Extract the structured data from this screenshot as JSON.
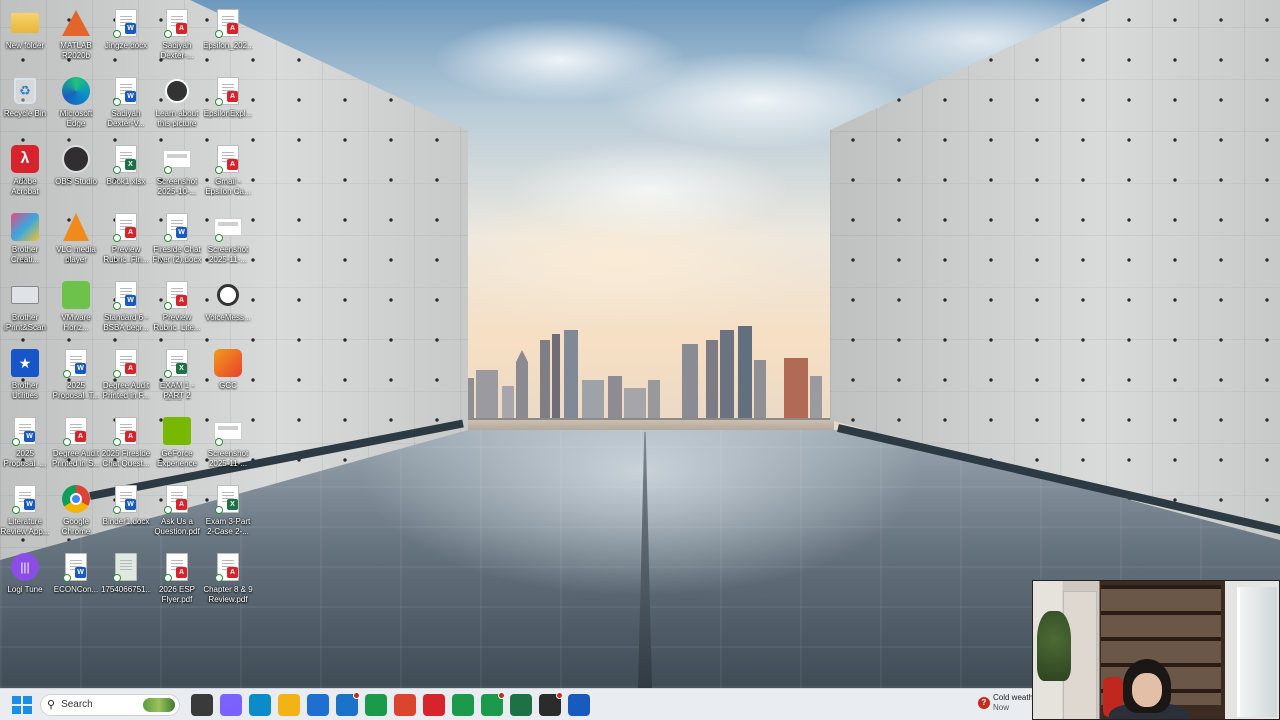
{
  "desktop": {
    "icons": [
      {
        "label": "New folder",
        "icon": "folder-icon"
      },
      {
        "label": "MATLAB R2020b",
        "icon": "matlab-icon"
      },
      {
        "label": "Jingze.docx",
        "icon": "word-doc-icon"
      },
      {
        "label": "Sadiyah Dexter-...",
        "icon": "pdf-doc-icon"
      },
      {
        "label": "Epsilon_202...",
        "icon": "pdf-doc-icon"
      },
      {
        "label": "Recycle Bin",
        "icon": "recycle-bin-icon"
      },
      {
        "label": "Microsoft Edge",
        "icon": "edge-icon"
      },
      {
        "label": "Sadiyah Dexter-V...",
        "icon": "word-doc-icon"
      },
      {
        "label": "Learn about this picture",
        "icon": "learn-picture-icon"
      },
      {
        "label": "EpsilonExpl...",
        "icon": "pdf-doc-icon"
      },
      {
        "label": "Adobe Acrobat",
        "icon": "acrobat-icon"
      },
      {
        "label": "OBS Studio",
        "icon": "obs-icon"
      },
      {
        "label": "Book1.xlsx",
        "icon": "excel-doc-icon"
      },
      {
        "label": "Screenshot 2025-10-...",
        "icon": "screenshot-icon"
      },
      {
        "label": "Gmail - Epsilon Ca...",
        "icon": "pdf-doc-icon"
      },
      {
        "label": "Brother Creati...",
        "icon": "brother-creative-icon"
      },
      {
        "label": "VLC media player",
        "icon": "vlc-icon"
      },
      {
        "label": "Preview Rubric_Fin...",
        "icon": "pdf-doc-icon"
      },
      {
        "label": "Fireside Chat Flyer (2).docx",
        "icon": "word-doc-icon"
      },
      {
        "label": "Screenshot 2025-11-...",
        "icon": "screenshot-icon"
      },
      {
        "label": "Brother iPrint&Scan",
        "icon": "brother-scan-icon"
      },
      {
        "label": "VMware Horiz...",
        "icon": "vmware-icon"
      },
      {
        "label": "Standard 6 -BSBA degr...",
        "icon": "word-doc-icon"
      },
      {
        "label": "Preview Rubric_Lite...",
        "icon": "pdf-doc-icon"
      },
      {
        "label": "VoiceMess...",
        "icon": "voice-message-icon"
      },
      {
        "label": "Brother Utilities",
        "icon": "brother-utilities-icon"
      },
      {
        "label": "2025 Proposal_T...",
        "icon": "word-doc-icon"
      },
      {
        "label": "Degree Audit Printed in F...",
        "icon": "pdf-doc-icon"
      },
      {
        "label": "EXAM 1 - PART 2 EXC...",
        "icon": "excel-doc-icon"
      },
      {
        "label": "GCC",
        "icon": "gcc-icon"
      },
      {
        "label": "2025 Proposal_...",
        "icon": "word-doc-icon"
      },
      {
        "label": "Degree Audit Printed in S...",
        "icon": "pdf-doc-icon"
      },
      {
        "label": "2025 Fireside Chat Quest...",
        "icon": "pdf-doc-icon"
      },
      {
        "label": "GeForce Experience",
        "icon": "geforce-icon"
      },
      {
        "label": "Screenshot 2025-11-...",
        "icon": "screenshot-icon"
      },
      {
        "label": "Literature Review App...",
        "icon": "word-doc-icon"
      },
      {
        "label": "Google Chrome",
        "icon": "chrome-icon"
      },
      {
        "label": "Binder1.docx",
        "icon": "word-doc-icon"
      },
      {
        "label": "Ask Us a Question.pdf",
        "icon": "pdf-doc-icon"
      },
      {
        "label": "Exam 3-Part 2-Case 2-...",
        "icon": "excel-doc-icon"
      },
      {
        "label": "Logi Tune",
        "icon": "logi-tune-icon"
      },
      {
        "label": "ECONCon...",
        "icon": "word-doc-icon"
      },
      {
        "label": "1754066751...",
        "icon": "image-file-icon"
      },
      {
        "label": "2026 ESP Flyer.pdf",
        "icon": "pdf-doc-icon"
      },
      {
        "label": "Chapter 8 & 9 Review.pdf",
        "icon": "pdf-doc-icon"
      }
    ]
  },
  "taskbar": {
    "search_placeholder": "Search",
    "apps": [
      {
        "name": "task-view",
        "icon": "task-view-icon",
        "color": "#3a3a3a"
      },
      {
        "name": "copilot",
        "icon": "copilot-icon",
        "color": "#7b61ff"
      },
      {
        "name": "edge",
        "icon": "edge-icon",
        "color": "#0b8bc9"
      },
      {
        "name": "file-explorer",
        "icon": "folder-icon",
        "color": "#f2b316"
      },
      {
        "name": "microsoft-store",
        "icon": "store-icon",
        "color": "#1f6fd1"
      },
      {
        "name": "outlook",
        "icon": "outlook-icon",
        "color": "#1a73c9"
      },
      {
        "name": "chrome-profile-1",
        "icon": "chrome-icon",
        "color": "#1a9a4a"
      },
      {
        "name": "chrome-profile-2",
        "icon": "chrome-icon",
        "color": "#d9452f"
      },
      {
        "name": "acrobat",
        "icon": "acrobat-icon",
        "color": "#d7232b"
      },
      {
        "name": "chrome-profile-3",
        "icon": "chrome-icon",
        "color": "#1a9a4a"
      },
      {
        "name": "chrome-profile-4",
        "icon": "chrome-icon",
        "color": "#1a9a4a"
      },
      {
        "name": "excel",
        "icon": "excel-icon",
        "color": "#1e7145"
      },
      {
        "name": "obs-studio",
        "icon": "obs-icon",
        "color": "#2b2b2b"
      },
      {
        "name": "word",
        "icon": "word-icon",
        "color": "#185abd"
      }
    ],
    "weather": {
      "text": "Cold weath",
      "sub": "Now",
      "alert": "?"
    }
  },
  "colors": {
    "accent": "#1a8fe8",
    "taskbar": "#e9edf2"
  }
}
